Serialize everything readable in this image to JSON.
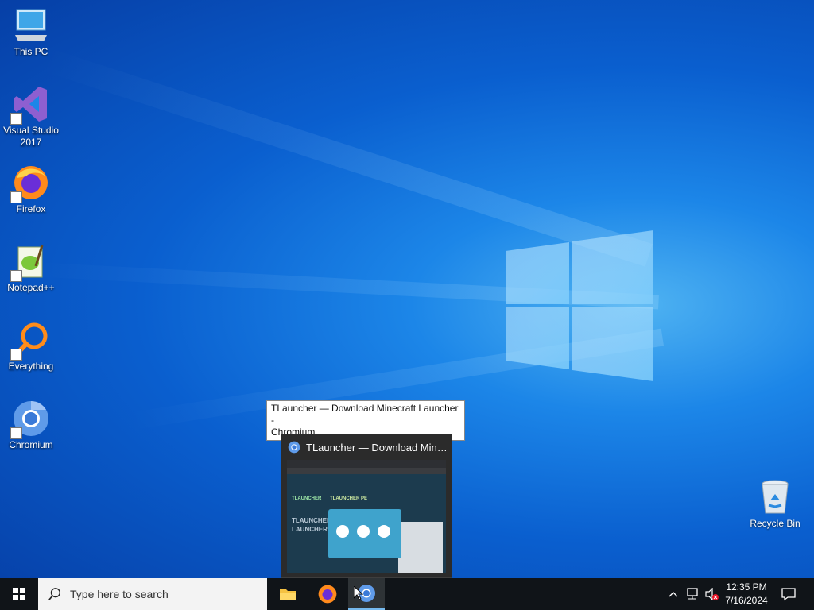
{
  "desktop": {
    "icons": [
      {
        "label": "This PC",
        "icon": "computer-icon"
      },
      {
        "label": "Visual Studio 2017",
        "icon": "visual-studio-icon"
      },
      {
        "label": "Firefox",
        "icon": "firefox-icon"
      },
      {
        "label": "Notepad++",
        "icon": "notepadpp-icon"
      },
      {
        "label": "Everything",
        "icon": "everything-search-icon"
      },
      {
        "label": "Chromium",
        "icon": "chromium-icon"
      },
      {
        "label": "Recycle Bin",
        "icon": "recycle-bin-icon"
      }
    ],
    "wallpaper_accent": "#0a5fcf"
  },
  "tooltip": {
    "text_line1": "TLauncher — Download Minecraft Launcher -",
    "text_line2": "Chromium"
  },
  "preview": {
    "title": "TLauncher — Download Minecr...",
    "icon": "chromium-icon",
    "thumbnail": {
      "brand": "TLAUNCHER",
      "tab_pe": "TLAUNCHER PE",
      "hero_line1": "TLAUNCHER",
      "hero_line2": "LAUNCHER"
    }
  },
  "taskbar": {
    "start_icon": "windows-start-icon",
    "search_placeholder": "Type here to search",
    "search_icon": "search-icon",
    "apps": [
      {
        "name": "File Explorer",
        "icon": "folder-icon"
      },
      {
        "name": "Firefox",
        "icon": "firefox-icon"
      },
      {
        "name": "Chromium",
        "icon": "chromium-icon",
        "active": true
      }
    ],
    "tray": {
      "chevron_icon": "chevron-up-icon",
      "network_icon": "network-icon",
      "volume_icon": "volume-muted-icon",
      "time": "12:35 PM",
      "date": "7/16/2024",
      "notification_icon": "action-center-icon"
    }
  }
}
